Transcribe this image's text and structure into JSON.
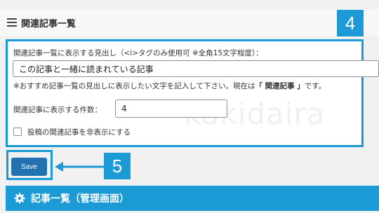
{
  "panel": {
    "title": "関連記事一覧"
  },
  "badges": {
    "step4": "4",
    "step5": "5"
  },
  "form": {
    "heading_label": "関連記事一覧に表示する見出し（<i>タグのみ使用可 ※全角15文字程度）：",
    "heading_value": "この記事と一緒に読まれている記事",
    "help_prefix": "※おすすめ記事一覧の見出しに表示したい文字を記入して下さい。現在は",
    "help_current": "「 関連記事 」",
    "help_suffix": "です。",
    "count_label": "関連記事に表示する件数：",
    "count_value": "4",
    "hide_label": "投稿の関連記事を非表示にする"
  },
  "watermark": "kakidaira",
  "save": {
    "label": "Save"
  },
  "section": {
    "title": "記事一覧（管理画面）"
  },
  "colors": {
    "accent": "#1b9ad6",
    "button": "#2271b1"
  },
  "icons": {
    "list": "list-icon",
    "gear": "gear-icon",
    "arrow": "arrow-left-icon"
  }
}
